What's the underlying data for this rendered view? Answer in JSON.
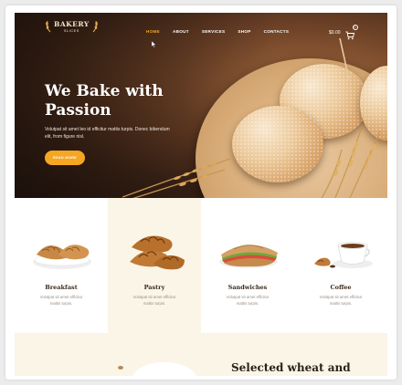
{
  "brand": {
    "title": "BAKERY",
    "subtitle": "SLICES"
  },
  "nav": {
    "items": [
      {
        "label": "HOME",
        "active": true
      },
      {
        "label": "ABOUT",
        "active": false
      },
      {
        "label": "SERVICES",
        "active": false
      },
      {
        "label": "SHOP",
        "active": false
      },
      {
        "label": "CONTACTS",
        "active": false
      }
    ]
  },
  "cart": {
    "price": "$0.00",
    "count": "0",
    "icon": "cart-icon"
  },
  "hero": {
    "headline_line1": "We Bake with",
    "headline_line2": "Passion",
    "subtext": "Volutpat sit amet leo id efficitur mattis turpis. Donec bibendum elit, from figure nisl.",
    "cta_label": "READ MORE"
  },
  "categories": [
    {
      "title": "Breakfast",
      "desc": "Volutpat sit amet efficitur mattis turpis.",
      "icon": "croissant-plate-image"
    },
    {
      "title": "Pastry",
      "desc": "Volutpat sit amet efficitur mattis turpis.",
      "icon": "croissants-image"
    },
    {
      "title": "Sandwiches",
      "desc": "Volutpat sit amet efficitur mattis turpis.",
      "icon": "sandwich-image"
    },
    {
      "title": "Coffee",
      "desc": "Volutpat sit amet efficitur mattis turpis.",
      "icon": "coffee-cup-image"
    }
  ],
  "section": {
    "heading": "Selected wheat and"
  },
  "colors": {
    "accent": "#f5a623",
    "hero_dark": "#3d2417",
    "cream": "#fbf5e8",
    "heading": "#2c2118"
  }
}
